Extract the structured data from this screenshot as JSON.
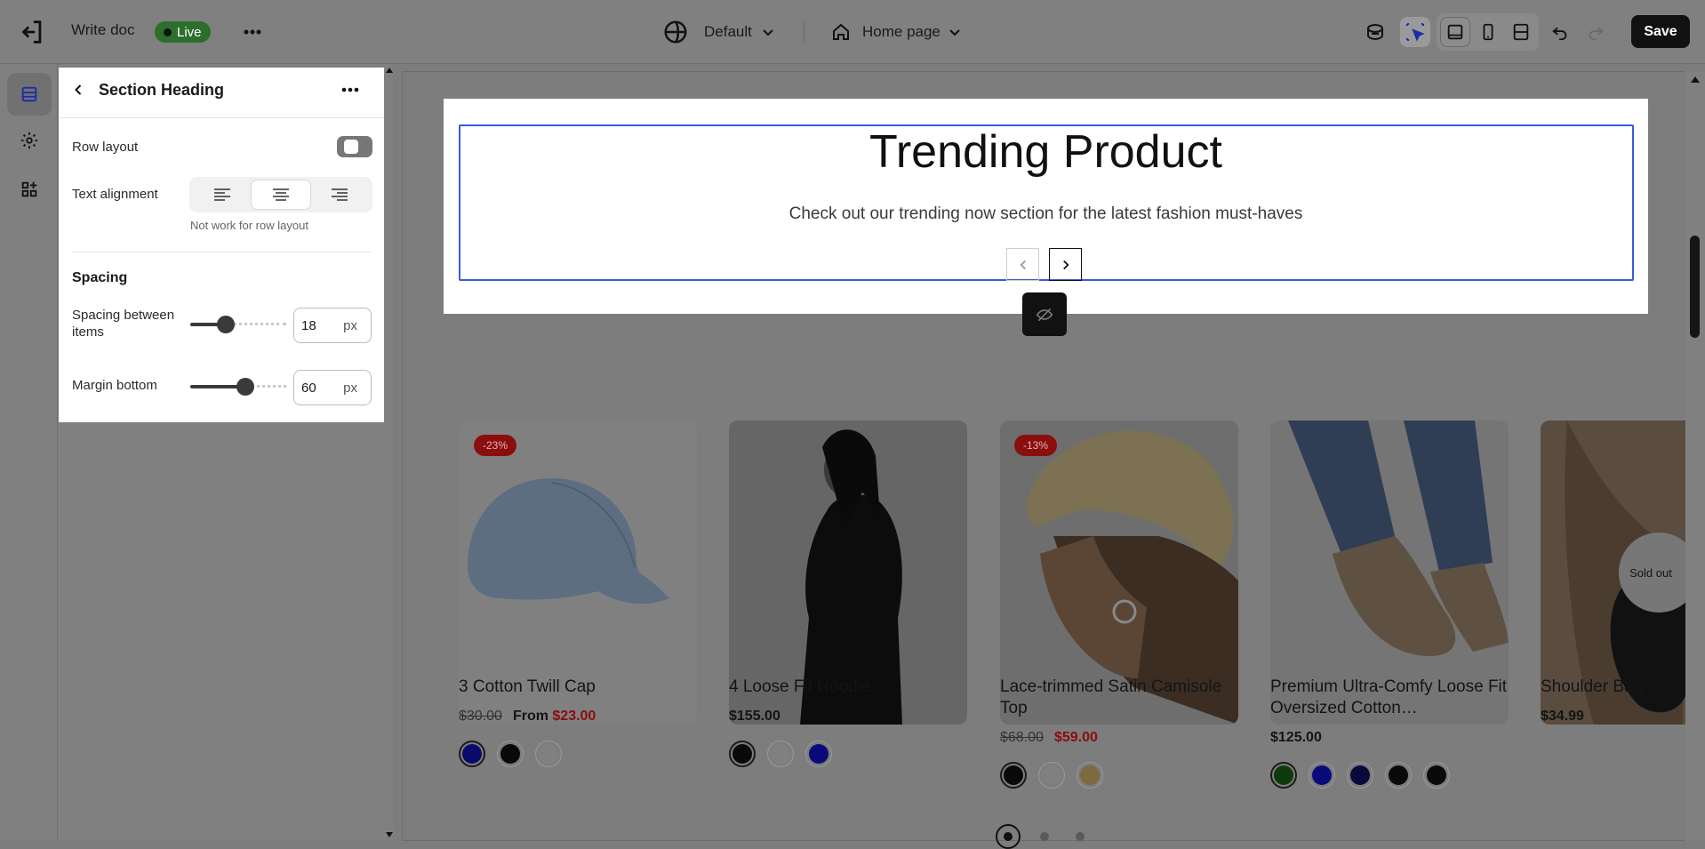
{
  "header": {
    "doc_title": "Write doc",
    "live_label": "Live",
    "theme_label": "Default",
    "page_label": "Home page",
    "save_label": "Save"
  },
  "panel": {
    "title": "Section Heading",
    "row_layout_label": "Row layout",
    "text_alignment_label": "Text alignment",
    "alignment_note": "Not work for row layout",
    "spacing_heading": "Spacing",
    "spacing_between_label": "Spacing between items",
    "spacing_between_value": "18",
    "margin_bottom_label": "Margin bottom",
    "margin_bottom_value": "60",
    "unit": "px"
  },
  "canvas": {
    "heading": "Trending Product",
    "subheading": "Check out our trending now section for the latest fashion must-haves",
    "products": [
      {
        "name": "3 Cotton Twill Cap",
        "old_price": "$30.00",
        "price": "From $23.00",
        "badge": "-23%"
      },
      {
        "name": "4 Loose Fit Hoodie",
        "price": "$155.00"
      },
      {
        "name": "Lace-trimmed Satin Camisole Top",
        "old_price": "$68.00",
        "price": "$59.00",
        "badge": "-13%"
      },
      {
        "name": "Premium Ultra-Comfy Loose Fit Oversized Cotton…",
        "price": "$125.00"
      },
      {
        "name": "Shoulder Bag",
        "price": "$34.99",
        "status": "Sold out"
      }
    ]
  },
  "colors": {
    "live_green": "#2c6e2c",
    "sale_red": "#8a0d0d",
    "selection_blue": "#3b5bdb"
  }
}
